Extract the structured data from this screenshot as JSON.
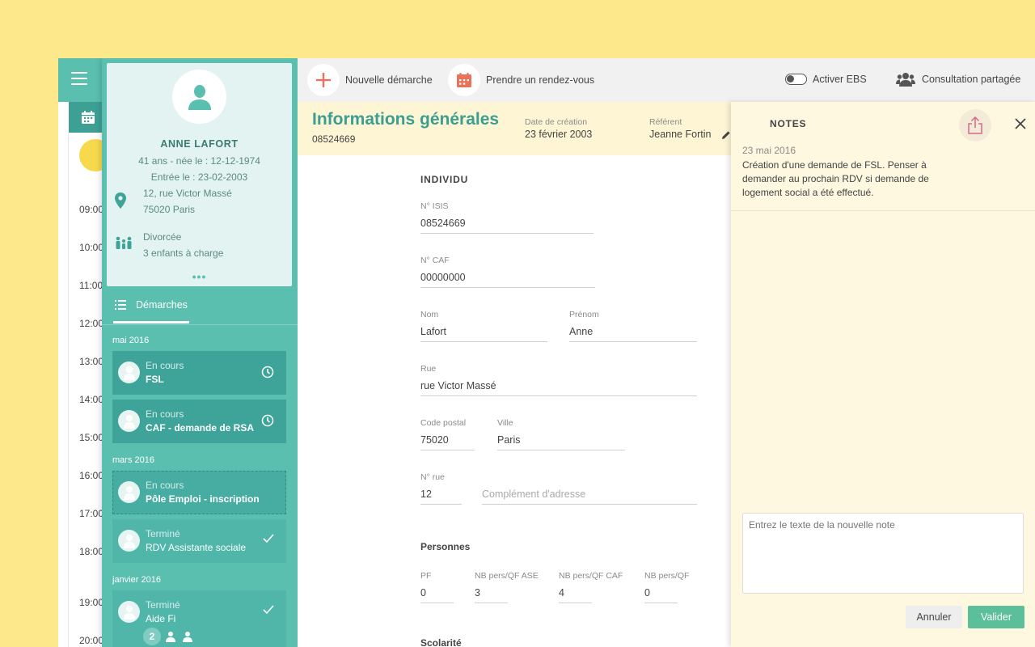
{
  "rail": {
    "hours": [
      "09:00",
      "10:00",
      "11:00",
      "12:00",
      "13:00",
      "14:00",
      "15:00",
      "16:00",
      "17:00",
      "18:00",
      "19:00",
      "20:00"
    ]
  },
  "profile": {
    "name": "ANNE LAFORT",
    "age": "41 ans - née le : 12-12-1974",
    "entry": "Entrée le : 23-02-2003",
    "address_line1": "12, rue Victor Massé",
    "address_line2": "75020 Paris",
    "family_line1": "Divorcée",
    "family_line2": "3 enfants à charge",
    "more": "•••"
  },
  "demarches": {
    "tab_label": "Démarches",
    "groups": [
      {
        "label": "mai 2016",
        "items": [
          {
            "status": "En cours",
            "title": "FSL",
            "icon": "clock-icon"
          },
          {
            "status": "En cours",
            "title": "CAF - demande de RSA",
            "icon": "clock-icon"
          }
        ]
      },
      {
        "label": "mars 2016",
        "items": [
          {
            "status": "En cours",
            "title": "Pôle Emploi - inscription"
          },
          {
            "status": "Terminé",
            "title": "RDV Assistante sociale",
            "icon": "check-icon"
          }
        ]
      },
      {
        "label": "janvier 2016",
        "items": [
          {
            "status": "Terminé",
            "title": "Aide Fi",
            "icon": "check-icon",
            "participants_count": "2"
          }
        ]
      }
    ]
  },
  "toolbar": {
    "new_label": "Nouvelle démarche",
    "appointment_label": "Prendre un rendez-vous",
    "ebs_label": "Activer EBS",
    "shared_label": "Consultation partagée"
  },
  "info": {
    "title": "Informations générales",
    "number": "08524669",
    "created_label": "Date de création",
    "created_value": "23 février 2003",
    "referent_label": "Référent",
    "referent_value": "Jeanne Fortin"
  },
  "form": {
    "section_individu": "INDIVIDU",
    "isis_label": "N° ISIS",
    "isis_value": "08524669",
    "caf_label": "N° CAF",
    "caf_value": "00000000",
    "nom_label": "Nom",
    "nom_value": "Lafort",
    "prenom_label": "Prénom",
    "prenom_value": "Anne",
    "rue_label": "Rue",
    "rue_value": "rue Victor Massé",
    "cp_label": "Code postal",
    "cp_value": "75020",
    "ville_label": "Ville",
    "ville_value": "Paris",
    "nrue_label": "N° rue",
    "nrue_value": "12",
    "complement_placeholder": "Complément d'adresse",
    "section_personnes": "Personnes",
    "pf_label": "PF",
    "pf_value": "0",
    "ase_label": "NB pers/QF ASE",
    "ase_value": "3",
    "cafqf_label": "NB pers/QF CAF",
    "cafqf_value": "4",
    "qf_label": "NB pers/QF",
    "qf_value": "0",
    "section_scolarite": "Scolarité"
  },
  "notes": {
    "title": "NOTES",
    "date": "23 mai 2016",
    "text": "Création d'une demande de FSL. Penser à demander au prochain RDV si demande de logement social a été effectué.",
    "input_placeholder": "Entrez le texte de la nouvelle note",
    "cancel_label": "Annuler",
    "validate_label": "Valider"
  },
  "colors": {
    "teal": "#5bbfb0",
    "teal_dark": "#3ea398",
    "yellow_bg": "#fde98b",
    "notes_bg": "#fdf8df",
    "accent_red": "#e8735a",
    "validate_green": "#5bbf9a"
  }
}
